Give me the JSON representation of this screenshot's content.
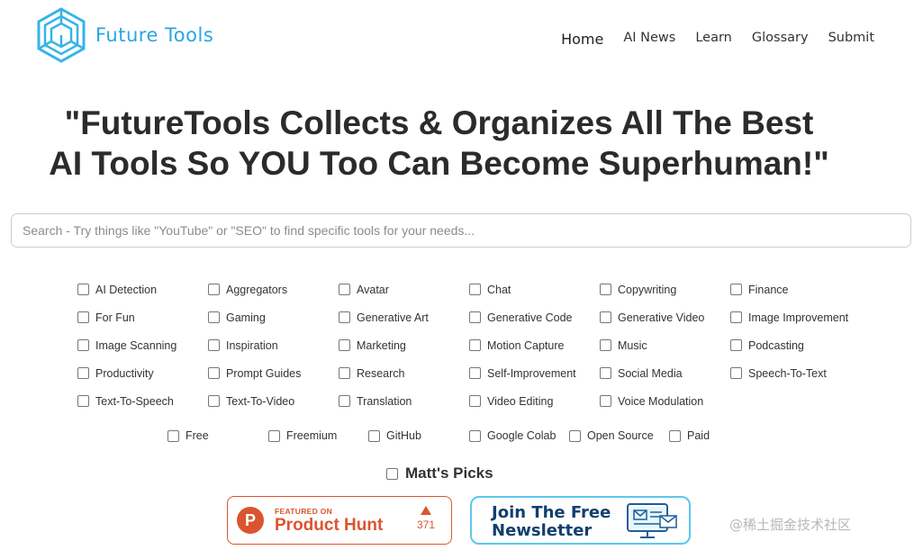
{
  "brand": {
    "name": "Future Tools"
  },
  "nav": [
    {
      "label": "Home"
    },
    {
      "label": "AI News"
    },
    {
      "label": "Learn"
    },
    {
      "label": "Glossary"
    },
    {
      "label": "Submit"
    }
  ],
  "hero": {
    "line1": "\"FutureTools Collects & Organizes All The Best",
    "line2": "AI Tools So YOU Too Can Become Superhuman!\""
  },
  "search": {
    "placeholder": "Search - Try things like \"YouTube\" or \"SEO\" to find specific tools for your needs...",
    "value": ""
  },
  "categories": [
    "AI Detection",
    "Aggregators",
    "Avatar",
    "Chat",
    "Copywriting",
    "Finance",
    "For Fun",
    "Gaming",
    "Generative Art",
    "Generative Code",
    "Generative Video",
    "Image Improvement",
    "Image Scanning",
    "Inspiration",
    "Marketing",
    "Motion Capture",
    "Music",
    "Podcasting",
    "Productivity",
    "Prompt Guides",
    "Research",
    "Self-Improvement",
    "Social Media",
    "Speech-To-Text",
    "Text-To-Speech",
    "Text-To-Video",
    "Translation",
    "Video Editing",
    "Voice Modulation"
  ],
  "pricing": [
    "Free",
    "Freemium",
    "GitHub",
    "Google Colab",
    "Open Source",
    "Paid"
  ],
  "picks_label": "Matt's Picks",
  "product_hunt": {
    "featured": "FEATURED ON",
    "name": "Product Hunt",
    "votes": "371",
    "logo_letter": "P",
    "color": "#da552f"
  },
  "newsletter": {
    "line1": "Join The Free",
    "line2": "Newsletter",
    "color": "#10406e"
  },
  "watermark": "@稀土掘金技术社区",
  "colors": {
    "brand": "#2aa6e0",
    "accent_border": "#5ac8ee"
  }
}
